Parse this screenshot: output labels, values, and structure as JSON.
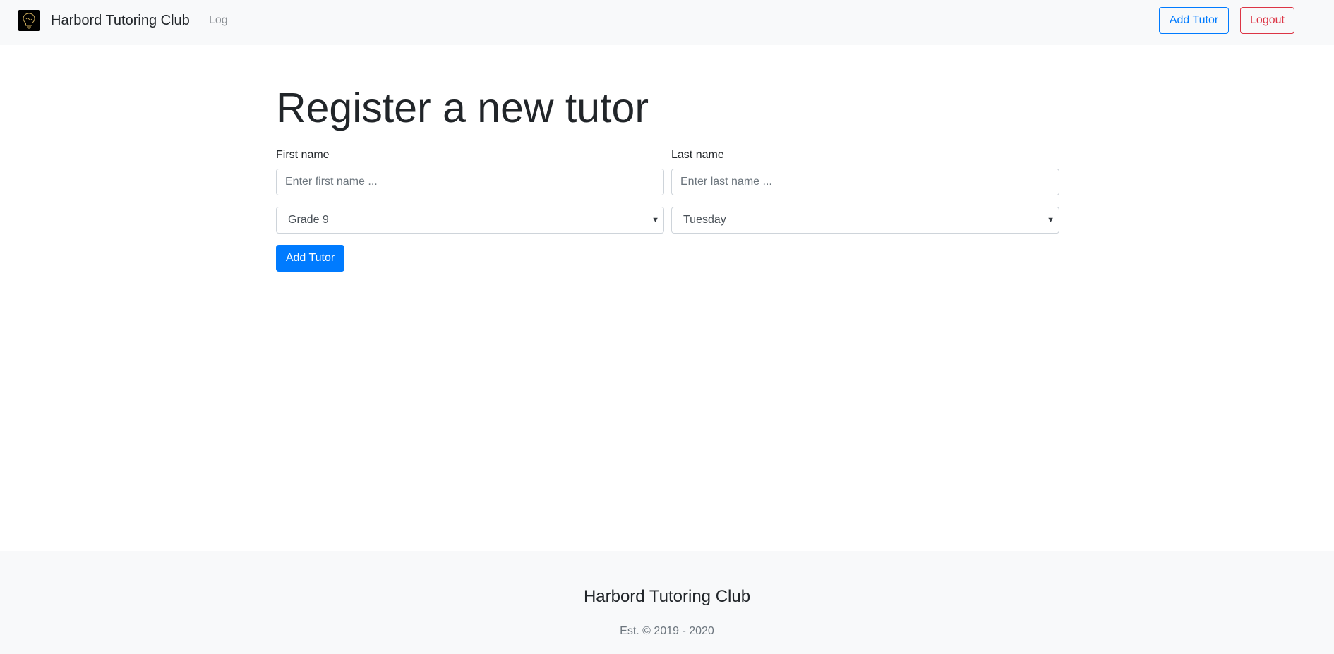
{
  "navbar": {
    "logo": "lightbulb-logo-icon",
    "brand": "Harbord Tutoring Club",
    "links": {
      "log": "Log"
    },
    "add_tutor_label": "Add Tutor",
    "logout_label": "Logout"
  },
  "form": {
    "title": "Register a new tutor",
    "first_name": {
      "label": "First name",
      "placeholder": "Enter first name ...",
      "value": ""
    },
    "last_name": {
      "label": "Last name",
      "placeholder": "Enter last name ...",
      "value": ""
    },
    "grade_select": {
      "selected": "Grade 9"
    },
    "day_select": {
      "selected": "Tuesday"
    },
    "submit_label": "Add Tutor"
  },
  "footer": {
    "title": "Harbord Tutoring Club",
    "est": "Est. © 2019 - 2020"
  },
  "colors": {
    "primary": "#007bff",
    "danger": "#dc3545",
    "navbar_bg": "#f8f9fa",
    "footer_bg": "#f8f9fa"
  }
}
